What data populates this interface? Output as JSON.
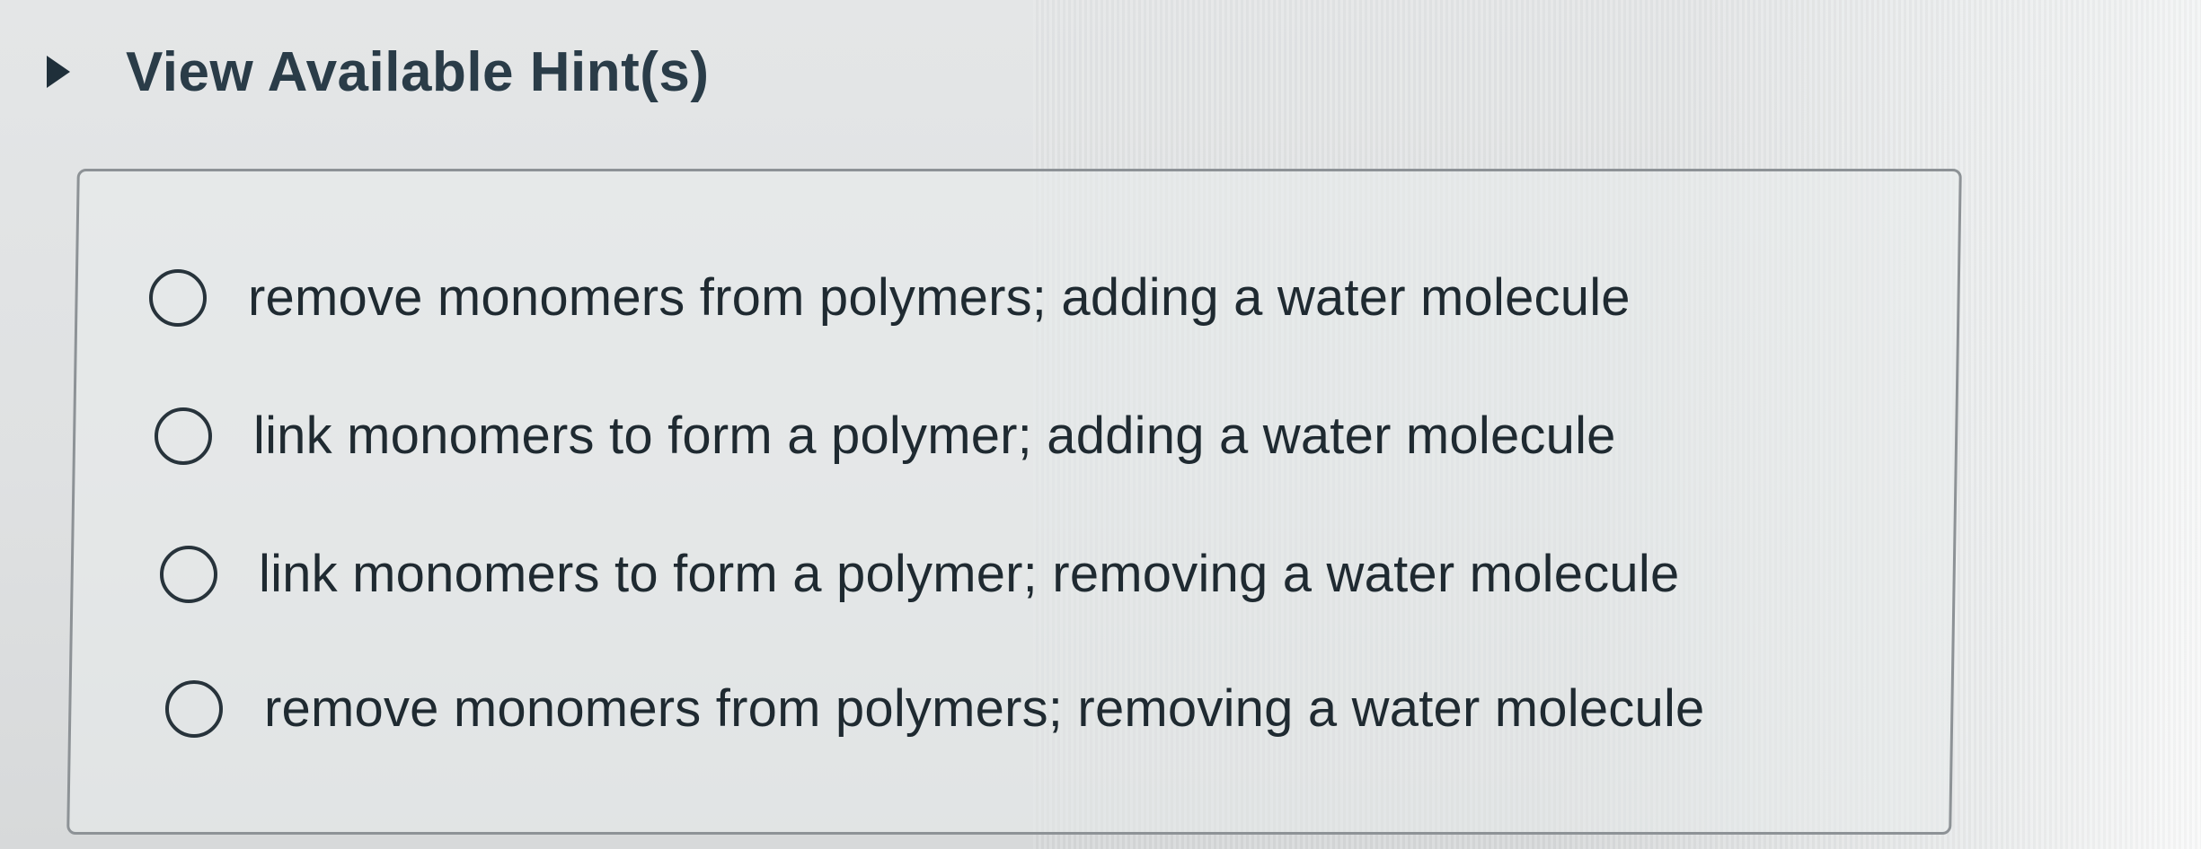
{
  "hint": {
    "label": "View Available Hint(s)",
    "icon": "caret-right-icon",
    "expanded": false
  },
  "question": {
    "type": "single-choice",
    "selected": null,
    "options": [
      {
        "label": "remove monomers from polymers; adding a water molecule",
        "checked": false
      },
      {
        "label": "link monomers to form a polymer; adding a water molecule",
        "checked": false
      },
      {
        "label": "link monomers to form a polymer; removing a water molecule",
        "checked": false
      },
      {
        "label": "remove monomers from polymers; removing a water molecule",
        "checked": false
      }
    ]
  },
  "colors": {
    "text": "#1f2a31",
    "heading": "#2a3c48",
    "border": "#8d9296",
    "background": "#e1e3e4"
  }
}
